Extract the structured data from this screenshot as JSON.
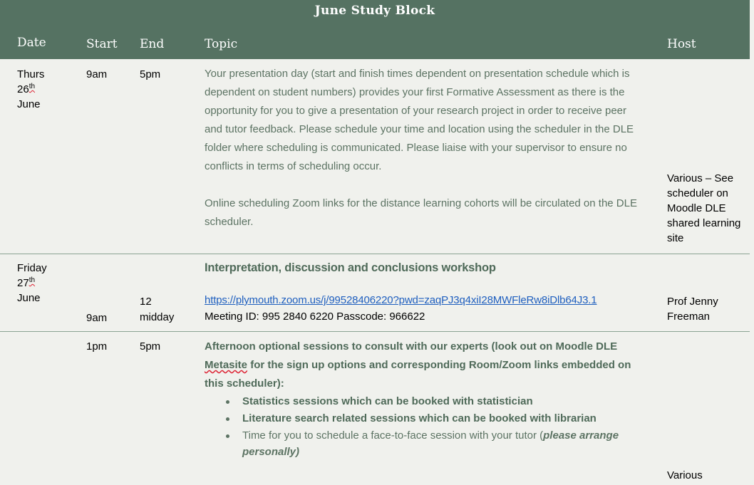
{
  "header": {
    "title": "June Study Block",
    "columns": [
      "Date",
      "Start",
      "End",
      "Topic",
      "Host"
    ]
  },
  "rows": [
    {
      "date_line1": "Thurs",
      "date_line2": "26",
      "date_sup": "th",
      "date_line3": "June",
      "start": "9am",
      "end": "5pm",
      "topic_p1": "Your presentation day (start and finish times dependent on presentation schedule which is dependent on student numbers) provides your first Formative Assessment as there is the opportunity for you to give a presentation of your research project in order to receive peer and tutor feedback. Please schedule your time and location using the scheduler in the DLE folder where scheduling is communicated. Please liaise with your supervisor to ensure no conflicts in terms of scheduling occur.",
      "topic_p2": "Online scheduling Zoom links for the distance learning cohorts will be circulated on the DLE scheduler.",
      "host": "Various – See scheduler on Moodle DLE shared learning site"
    },
    {
      "date_line1": "Friday",
      "date_line2": "27",
      "date_sup": "th",
      "date_line3": "June",
      "start": "9am",
      "end_line1": "12",
      "end_line2": "midday",
      "topic_title": "Interpretation, discussion and conclusions workshop",
      "topic_link": "https://plymouth.zoom.us/j/99528406220?pwd=zaqPJ3q4xiI28MWFleRw8iDlb64J3.1",
      "topic_meeting": "Meeting ID: 995 2840 6220 Passcode: 966622",
      "host": "Prof Jenny Freeman"
    },
    {
      "start": "1pm",
      "end": "5pm",
      "topic_intro_a": "Afternoon optional sessions to consult with our experts (look out on Moodle DLE ",
      "topic_intro_word": "Metasite",
      "topic_intro_b": " for the sign up options and corresponding Room/Zoom links embedded on this scheduler):",
      "bullets": [
        "Statistics sessions which can be booked with statistician",
        "Literature search related sessions which can be booked with librarian"
      ],
      "bullet3_text": "Time for you to schedule a face-to-face session with your tutor (",
      "bullet3_emph": "please arrange personally)",
      "host": "Various"
    }
  ]
}
